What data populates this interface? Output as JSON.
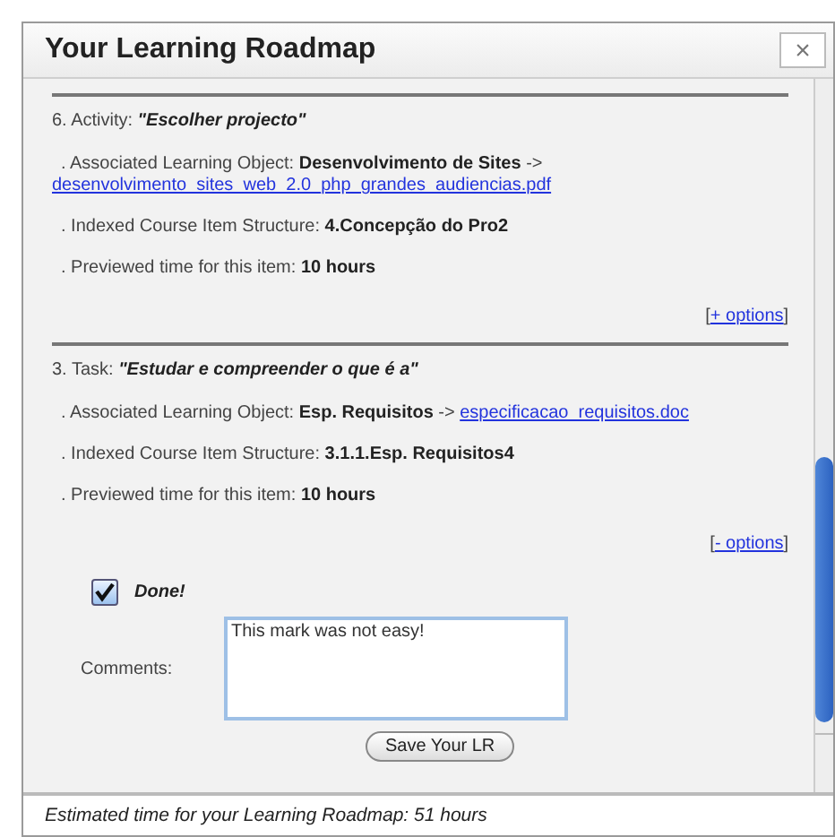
{
  "window": {
    "title": "Your Learning Roadmap",
    "close": "×"
  },
  "items": [
    {
      "heading": "6. Activity:",
      "name": "\"Escolher projecto\"",
      "lines": [
        {
          "text": ". Associated Learning Object: **Desenvolvimento de Sites** ->",
          "link": "desenvolvimento_sites_web_2.0_php_grandes_audiencias.pdf",
          "link_on_new_line": true
        },
        {
          "text": ". Indexed Course Item Structure: **4.Concepção do Pro2**"
        },
        {
          "text": ". Previewed time for this item: **10 hours**"
        }
      ],
      "options": {
        "open": "[",
        "link": "+ options",
        "close": "]"
      }
    },
    {
      "heading": "3. Task:",
      "name": "\"Estudar e compreender o que é a\"",
      "lines": [
        {
          "text": ". Associated Learning Object: **Esp. Requisitos** ->",
          "link": "especificacao_requisitos.doc",
          "link_on_new_line": false
        },
        {
          "text": ". Indexed Course Item Structure: **3.1.1.Esp. Requisitos4**"
        },
        {
          "text": ". Previewed time for this item: **10 hours**"
        }
      ],
      "options": {
        "open": "[",
        "link": "- options",
        "close": "]"
      }
    }
  ],
  "done": {
    "label": "Done!",
    "checked": true
  },
  "comments": {
    "label": "Comments:",
    "value": "This mark was not easy!"
  },
  "save_button": "Save Your LR",
  "status_bar": "Estimated time for your Learning Roadmap: 51 hours"
}
